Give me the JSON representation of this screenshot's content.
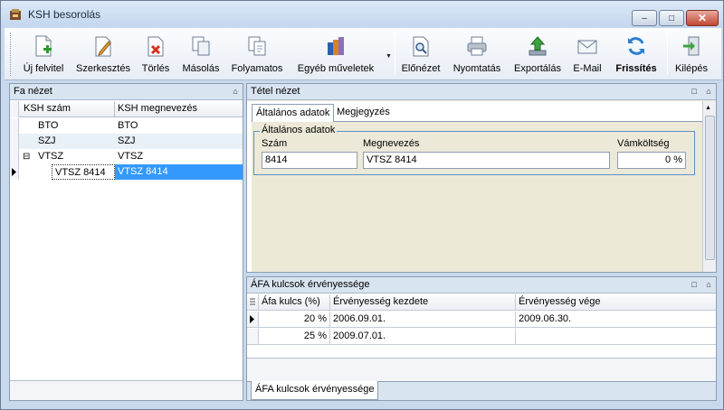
{
  "window": {
    "title": "KSH besorolás",
    "min_label": "–",
    "max_label": "□",
    "close_label": "✕"
  },
  "toolbar": {
    "buttons": [
      {
        "label": "Új felvitel",
        "icon": "new-record-icon"
      },
      {
        "label": "Szerkesztés",
        "icon": "edit-icon"
      },
      {
        "label": "Törlés",
        "icon": "delete-icon"
      },
      {
        "label": "Másolás",
        "icon": "copy-icon"
      },
      {
        "label": "Folyamatos",
        "icon": "continuous-icon"
      },
      {
        "label": "Egyéb műveletek",
        "icon": "other-actions-icon"
      },
      {
        "label": "Előnézet",
        "icon": "preview-icon"
      },
      {
        "label": "Nyomtatás",
        "icon": "print-icon"
      },
      {
        "label": "Exportálás",
        "icon": "export-icon"
      },
      {
        "label": "E-Mail",
        "icon": "email-icon"
      },
      {
        "label": "Frissítés",
        "icon": "refresh-icon"
      },
      {
        "label": "Kilépés",
        "icon": "exit-icon"
      }
    ],
    "dropdown_arrow": "▼"
  },
  "tree_panel": {
    "title": "Fa nézet",
    "columns": [
      "KSH szám",
      "KSH megnevezés"
    ],
    "rows": [
      {
        "code": "BTO",
        "name": "BTO",
        "expander": ""
      },
      {
        "code": "SZJ",
        "name": "SZJ",
        "expander": ""
      },
      {
        "code": "VTSZ",
        "name": "VTSZ",
        "expander": "⊟"
      },
      {
        "code": "VTSZ 8414",
        "name": "VTSZ 8414",
        "expander": "",
        "selected": true
      }
    ],
    "pin": "⌂"
  },
  "detail_panel": {
    "title": "Tétel nézet",
    "tabs": [
      "Általános adatok",
      "Megjegyzés"
    ],
    "group_title": "Általános adatok",
    "fields": {
      "szam_label": "Szám",
      "szam_value": "8414",
      "megnevezes_label": "Megnevezés",
      "megnevezes_value": "VTSZ 8414",
      "vamkoltseg_label": "Vámköltség",
      "vamkoltseg_value": "0 %"
    },
    "float_btn": "□",
    "pin": "⌂"
  },
  "afa_panel": {
    "title": "ÁFA kulcsok érvényessége",
    "columns": [
      "Áfa kulcs (%)",
      "Érvényesség kezdete",
      "Érvényesség vége"
    ],
    "rows": [
      {
        "rate": "20 %",
        "start": "2006.09.01.",
        "end": "2009.06.30."
      },
      {
        "rate": "25 %",
        "start": "2009.07.01.",
        "end": ""
      }
    ],
    "bottom_tab": "ÁFA kulcsok érvényessége",
    "float_btn": "□",
    "pin": "⌂"
  },
  "colors": {
    "selection": "#3399ff",
    "alt_row": "#e8f0f8",
    "form_bg": "#ece9d8"
  }
}
